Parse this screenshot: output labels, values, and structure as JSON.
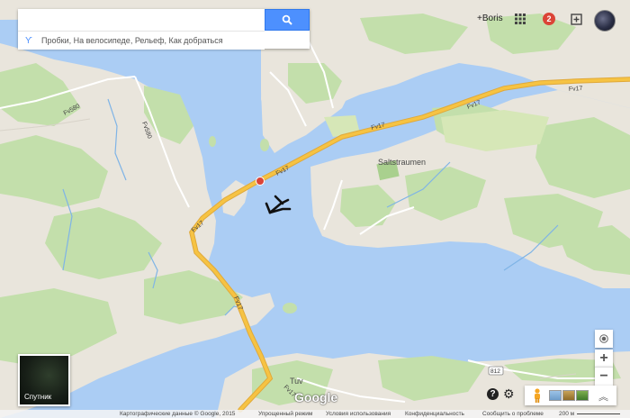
{
  "search": {
    "placeholder": "",
    "suggestions": "Пробки, На велосипеде, Рельеф, Как добраться"
  },
  "header": {
    "user_name": "+Boris",
    "notification_count": "2"
  },
  "map_labels": {
    "place_saltstraumen": "Saltstraumen",
    "place_tuv": "Tuv",
    "road_fv17": "Fv17",
    "road_fv580": "Fv580",
    "road_812": "812",
    "brand": "Google"
  },
  "controls": {
    "zoom_in": "+",
    "zoom_out": "−",
    "satellite_label": "Спутник"
  },
  "footer": {
    "map_data": "Картографические данные © Google, 2015",
    "simplified": "Упрощенный режим",
    "terms": "Условия использования",
    "privacy": "Конфиденциальность",
    "report": "Сообщить о проблеме",
    "scale": "200 м"
  },
  "colors": {
    "water": "#abcdf4",
    "land": "#e9e5dc",
    "forest": "#c3dfab",
    "highway": "#f6c343",
    "accent": "#4d90fe"
  }
}
